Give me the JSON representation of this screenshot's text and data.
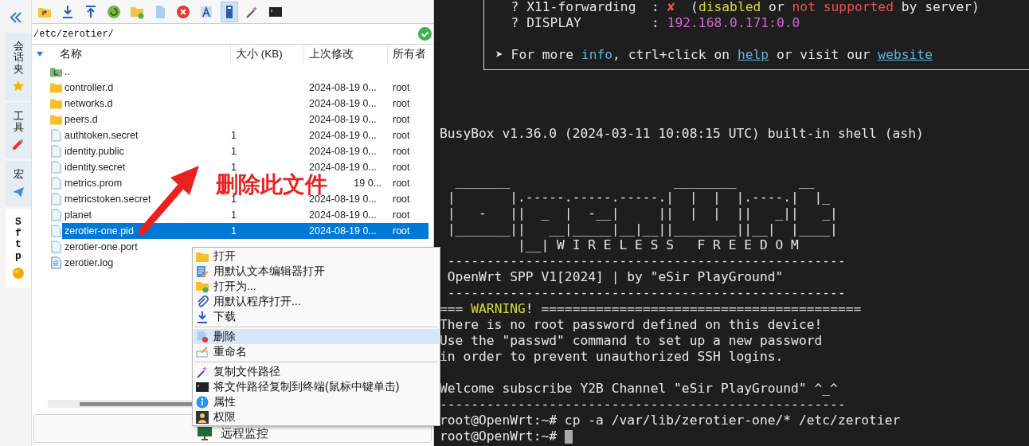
{
  "side_tabs": [
    {
      "label": "会话夹",
      "selected": false
    },
    {
      "label": "工具",
      "selected": false
    },
    {
      "label": "宏",
      "selected": false
    },
    {
      "label": "Sftp",
      "selected": true
    }
  ],
  "toolbar": [
    {
      "kind": "parent",
      "selected": false
    },
    {
      "kind": "download",
      "selected": false
    },
    {
      "kind": "upload",
      "selected": false
    },
    {
      "kind": "refresh",
      "selected": false
    },
    {
      "kind": "newfolder",
      "selected": false
    },
    {
      "kind": "newfile",
      "selected": false
    },
    {
      "kind": "delete",
      "selected": false
    },
    {
      "kind": "rename",
      "selected": false
    },
    {
      "kind": "follow",
      "selected": true
    },
    {
      "kind": "wand",
      "selected": false
    },
    {
      "kind": "terminal",
      "selected": false
    }
  ],
  "path": "/etc/zerotier/",
  "columns": [
    "名称",
    "大小 (KB)",
    "上次修改",
    "所有者"
  ],
  "rows": [
    {
      "kind": "parent",
      "name": "..",
      "selected": false
    },
    {
      "kind": "folder",
      "name": "controller.d",
      "modified": "2024-08-19 0...",
      "owner": "root",
      "selected": false
    },
    {
      "kind": "folder",
      "name": "networks.d",
      "modified": "2024-08-19 0...",
      "owner": "root",
      "selected": false
    },
    {
      "kind": "folder",
      "name": "peers.d",
      "modified": "2024-08-19 0...",
      "owner": "root",
      "selected": false
    },
    {
      "kind": "file",
      "name": "authtoken.secret",
      "size": "1",
      "modified": "2024-08-19 0...",
      "owner": "root",
      "selected": false
    },
    {
      "kind": "file",
      "name": "identity.public",
      "size": "1",
      "modified": "2024-08-19 0...",
      "owner": "root",
      "selected": false
    },
    {
      "kind": "file",
      "name": "identity.secret",
      "size": "1",
      "modified": "2024-08-19 0...",
      "owner": "root",
      "selected": false
    },
    {
      "kind": "file",
      "name": "metrics.prom",
      "modified": "19 0...",
      "owner": "root",
      "selected": false,
      "partly_covered": true
    },
    {
      "kind": "file",
      "name": "metricstoken.secret",
      "size": "1",
      "modified": "2024-08-19 0...",
      "owner": "root",
      "selected": false
    },
    {
      "kind": "file",
      "name": "planet",
      "size": "1",
      "modified": "2024-08-19 0...",
      "owner": "root",
      "selected": false
    },
    {
      "kind": "file",
      "name": "zerotier-one.pid",
      "size": "1",
      "modified": "2024-08-19 0...",
      "owner": "root",
      "selected": true
    },
    {
      "kind": "file",
      "name": "zerotier-one.port",
      "selected": false
    },
    {
      "kind": "log",
      "name": "zerotier.log",
      "selected": false
    }
  ],
  "monitor_button": "远程监控",
  "annotation": "删除此文件",
  "context_menu": [
    {
      "kind": "item",
      "label": "打开",
      "selected": false
    },
    {
      "kind": "item",
      "label": "用默认文本编辑器打开",
      "selected": false
    },
    {
      "kind": "item",
      "label": "打开为...",
      "selected": false
    },
    {
      "kind": "item",
      "label": "用默认程序打开...",
      "selected": false
    },
    {
      "kind": "item",
      "label": "下载",
      "selected": false
    },
    {
      "kind": "separator"
    },
    {
      "kind": "item",
      "label": "删除",
      "selected": true
    },
    {
      "kind": "item",
      "label": "重命名",
      "selected": false
    },
    {
      "kind": "separator"
    },
    {
      "kind": "item",
      "label": "复制文件路径",
      "selected": false
    },
    {
      "kind": "item",
      "label": "将文件路径复制到终端(鼠标中键单击)",
      "selected": false
    },
    {
      "kind": "item",
      "label": "属性",
      "selected": false
    },
    {
      "kind": "item",
      "label": "权限",
      "selected": false
    }
  ],
  "terminal": {
    "banner_box": [
      [
        {
          "kind": "plain",
          "text": "  ? X11-forwarding  : "
        },
        {
          "kind": "error",
          "text": "✘"
        },
        {
          "kind": "plain",
          "text": "  ("
        },
        {
          "kind": "warn",
          "text": "disabled"
        },
        {
          "kind": "plain",
          "text": " or "
        },
        {
          "kind": "error",
          "text": "not supported"
        },
        {
          "kind": "plain",
          "text": " by server)"
        }
      ],
      [
        {
          "kind": "plain",
          "text": "  ? DISPLAY         : "
        },
        {
          "kind": "value",
          "text": "192.168.0.171:0.0"
        }
      ],
      [
        {
          "kind": "plain",
          "text": "➤ For more "
        },
        {
          "kind": "info",
          "text": "info"
        },
        {
          "kind": "plain",
          "text": ", ctrl+click on "
        },
        {
          "kind": "link",
          "text": "help"
        },
        {
          "kind": "plain",
          "text": " or visit our "
        },
        {
          "kind": "link",
          "text": "website"
        }
      ]
    ],
    "sections": [
      [
        [
          {
            "kind": "plain",
            "text": "BusyBox v1.36.0 (2024-03-11 10:08:15 UTC) built-in shell (ash)"
          }
        ]
      ],
      [
        [
          {
            "kind": "plain",
            "text": "  _______                     ________        __"
          }
        ],
        [
          {
            "kind": "plain",
            "text": " |       |.-----.-----.-----.|  |  |  |.----.|  |_"
          }
        ],
        [
          {
            "kind": "plain",
            "text": " |   -   ||  _  |  -__|     ||  |  |  ||   _||   _|"
          }
        ],
        [
          {
            "kind": "plain",
            "text": " |_______||   __|_____|__|__||________||__|  |____|"
          }
        ],
        [
          {
            "kind": "plain",
            "text": "          |__| W I R E L E S S   F R E E D O M"
          }
        ],
        [
          {
            "kind": "plain",
            "text": " ---------------------------------------------------"
          }
        ],
        [
          {
            "kind": "plain",
            "text": " OpenWrt SPP V1[2024] | by \"eSir PlayGround\""
          }
        ],
        [
          {
            "kind": "plain",
            "text": " ---------------------------------------------------"
          }
        ],
        [
          {
            "kind": "plain",
            "text": "=== "
          },
          {
            "kind": "warn",
            "text": "WARNING"
          },
          {
            "kind": "plain",
            "text": "! ========================================="
          }
        ],
        [
          {
            "kind": "plain",
            "text": "There is no root password defined on this device!"
          }
        ],
        [
          {
            "kind": "plain",
            "text": "Use the \"passwd\" command to set up a new password"
          }
        ],
        [
          {
            "kind": "plain",
            "text": "in order to prevent unauthorized SSH logins."
          }
        ]
      ],
      [
        [
          {
            "kind": "plain",
            "text": "Welcome subscribe Y2B Channel \"eSir PlayGround\" ^_^"
          }
        ],
        [
          {
            "kind": "plain",
            "text": "----------------------------------------------------"
          }
        ],
        [
          {
            "kind": "plain",
            "text": "root@OpenWrt:~# cp -a /var/lib/zerotier-one/* /etc/zerotier"
          }
        ],
        [
          {
            "kind": "plain",
            "text": "root@OpenWrt:~#"
          }
        ]
      ]
    ],
    "cursor": true
  }
}
